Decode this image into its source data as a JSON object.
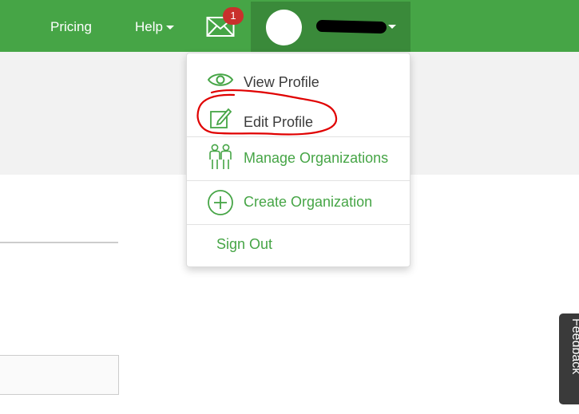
{
  "nav": {
    "pricing_label": "Pricing",
    "help_label": "Help",
    "mail_badge": "1"
  },
  "user_menu": {
    "items": [
      {
        "label": "View Profile",
        "icon": "eye-icon"
      },
      {
        "label": "Edit Profile",
        "icon": "edit-icon"
      },
      {
        "label": "Manage Organizations",
        "icon": "people-icon"
      },
      {
        "label": "Create Organization",
        "icon": "plus-circle-icon"
      },
      {
        "label": "Sign Out"
      }
    ]
  },
  "feedback_label": "Feedback",
  "colors": {
    "brand_green": "#46a546",
    "user_area_green": "#3a8a3a",
    "badge_red": "#c9302c",
    "annotation_red": "#e00000"
  }
}
